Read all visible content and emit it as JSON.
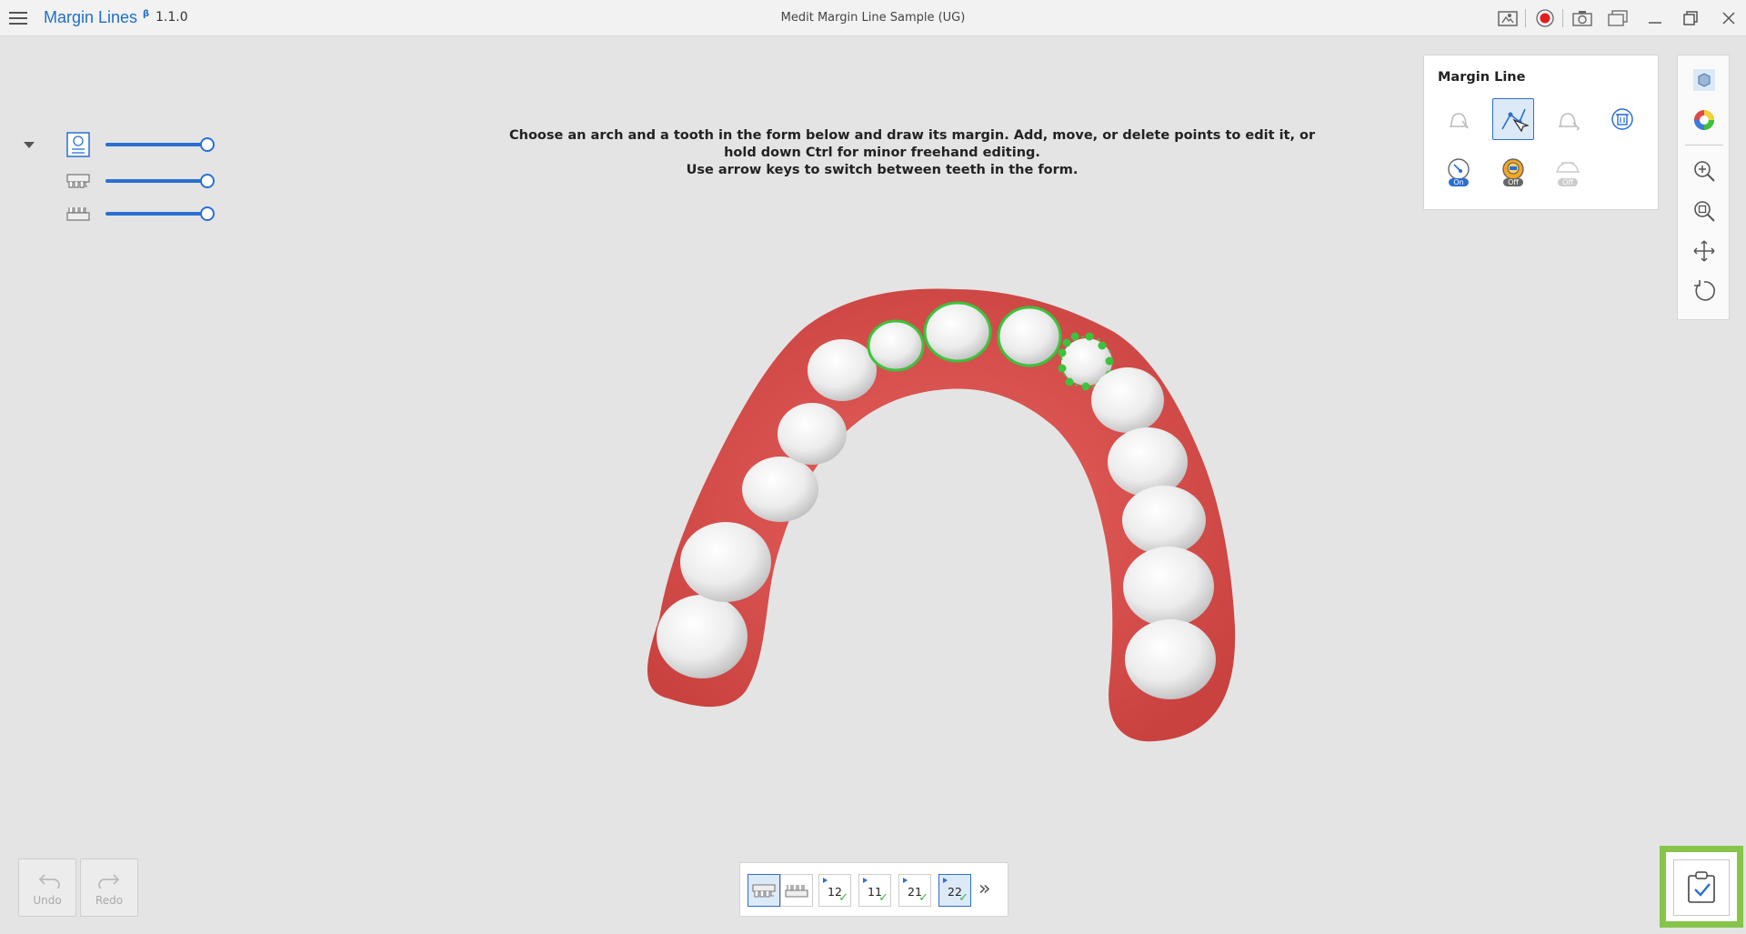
{
  "app": {
    "name": "Margin Lines",
    "beta_badge": "β",
    "version": "1.1.0",
    "window_title": "Medit Margin Line Sample (UG)"
  },
  "titlebar_icons": [
    "guide-icon",
    "record-icon",
    "screenshot-icon",
    "gallery-icon",
    "minimize-icon",
    "restore-icon",
    "close-icon"
  ],
  "layers": {
    "items": [
      {
        "name": "margin-form-layer",
        "opacity_percent": 100
      },
      {
        "name": "maxilla-layer",
        "opacity_percent": 100
      },
      {
        "name": "mandible-layer",
        "opacity_percent": 100
      }
    ]
  },
  "instructions": {
    "line1": "Choose an arch and a tooth in the form below and draw its margin. Add, move, or delete points to edit it, or",
    "line2": "hold down Ctrl for minor freehand editing.",
    "line3": "Use arrow keys to switch between teeth in the form."
  },
  "margin_panel": {
    "title": "Margin Line",
    "toggles": {
      "toggle1": "On",
      "toggle2": "Off",
      "toggle3": "Off"
    }
  },
  "undo": {
    "label": "Undo"
  },
  "redo": {
    "label": "Redo"
  },
  "tooth_bar": {
    "teeth": [
      {
        "number": "12",
        "done": "✓"
      },
      {
        "number": "11",
        "done": "✓"
      },
      {
        "number": "21",
        "done": "✓"
      },
      {
        "number": "22",
        "done": "✓"
      }
    ],
    "more": "»"
  },
  "colors": {
    "accent": "#2a6fd2",
    "gum": "#d9514f",
    "margin_line": "#3cc23c",
    "complete_border": "#86c54a"
  }
}
